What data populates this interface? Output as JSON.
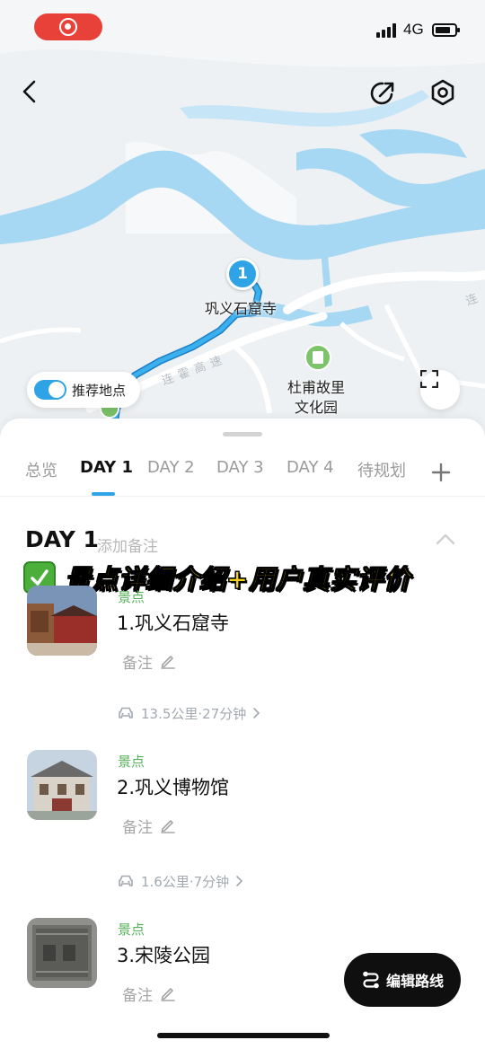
{
  "status_bar": {
    "network": "4G"
  },
  "map": {
    "marker_number": "1",
    "grotto_label": "巩义石窟寺",
    "dufu_label_line1": "杜甫故里",
    "dufu_label_line2": "文化园",
    "road_label_1": "连霍高速",
    "road_label_2": "连",
    "recommend_toggle_label": "推荐地点",
    "recommend_toggle_on": true
  },
  "tabs": [
    {
      "label": "总览"
    },
    {
      "label": "DAY 1"
    },
    {
      "label": "DAY 2"
    },
    {
      "label": "DAY 3"
    },
    {
      "label": "DAY 4"
    },
    {
      "label": "待规划"
    }
  ],
  "active_tab": "DAY 1",
  "day": {
    "title": "DAY 1",
    "add_note_label": "添加备注"
  },
  "banner": {
    "text": "景点详细介绍+用户真实评价"
  },
  "spots": [
    {
      "type": "景点",
      "name": "1.巩义石窟寺",
      "note_label": "备注"
    },
    {
      "type": "景点",
      "name": "2.巩义博物馆",
      "note_label": "备注"
    },
    {
      "type": "景点",
      "name": "3.宋陵公园",
      "note_label": "备注"
    }
  ],
  "transits": [
    {
      "text": "13.5公里·27分钟"
    },
    {
      "text": "1.6公里·7分钟"
    }
  ],
  "edit_route_label": "编辑路线",
  "colors": {
    "accent_blue": "#2ea4e6",
    "river_blue": "#a6d8f3",
    "spot_type_green": "#56b05a",
    "banner_yellow": "#f5d318",
    "record_red": "#e8413a"
  }
}
